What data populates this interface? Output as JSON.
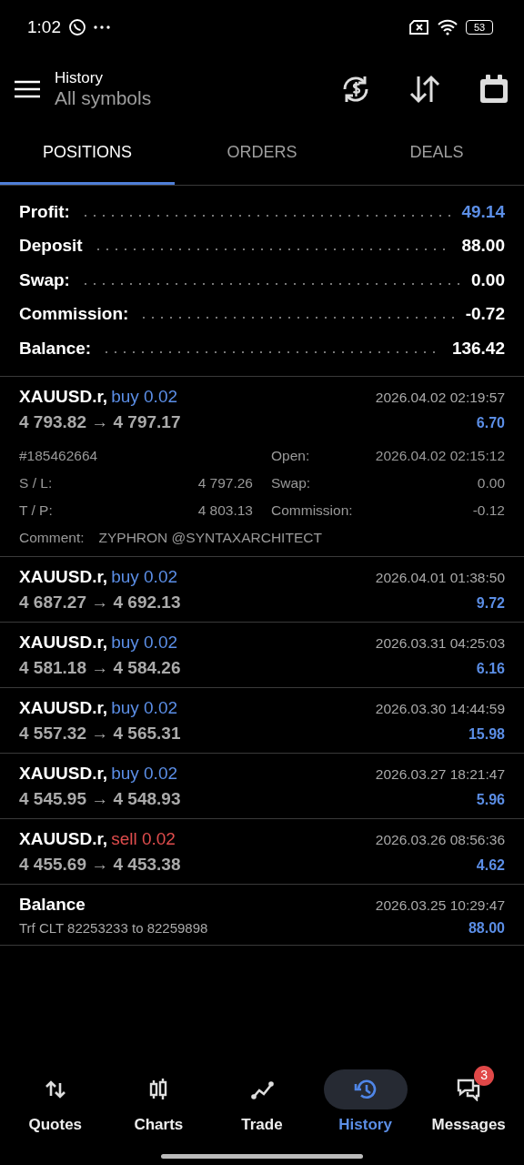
{
  "status_bar": {
    "time": "1:02",
    "battery": "53"
  },
  "header": {
    "title": "History",
    "subtitle": "All symbols"
  },
  "tabs": [
    {
      "label": "POSITIONS",
      "selected": true
    },
    {
      "label": "ORDERS",
      "selected": false
    },
    {
      "label": "DEALS",
      "selected": false
    }
  ],
  "summary": [
    {
      "label": "Profit:",
      "value": "49.14",
      "kind": "profit"
    },
    {
      "label": "Deposit",
      "value": "88.00",
      "kind": "plain"
    },
    {
      "label": "Swap:",
      "value": "0.00",
      "kind": "plain"
    },
    {
      "label": "Commission:",
      "value": "-0.72",
      "kind": "plain"
    },
    {
      "label": "Balance:",
      "value": "136.42",
      "kind": "plain"
    }
  ],
  "deals": [
    {
      "kind": "buy",
      "symbol": "XAUUSD.r,",
      "order": "buy 0.02",
      "prices": "4 793.82 → 4 797.17",
      "time": "2026.04.02 02:19:57",
      "profit": "6.70",
      "details": {
        "ticket": "#185462664",
        "open_label": "Open:",
        "open_time": "2026.04.02 02:15:12",
        "fields": [
          {
            "label": "S / L:",
            "value": "4 797.26"
          },
          {
            "label": "Swap:",
            "value": "0.00"
          },
          {
            "label": "T / P:",
            "value": "4 803.13"
          },
          {
            "label": "Commission:",
            "value": "-0.12"
          }
        ],
        "comment_label": "Comment:",
        "comment": "ZYPHRON @SYNTAXARCHITECT"
      }
    },
    {
      "kind": "buy",
      "symbol": "XAUUSD.r,",
      "order": "buy 0.02",
      "prices": "4 687.27 → 4 692.13",
      "time": "2026.04.01 01:38:50",
      "profit": "9.72"
    },
    {
      "kind": "buy",
      "symbol": "XAUUSD.r,",
      "order": "buy 0.02",
      "prices": "4 581.18 → 4 584.26",
      "time": "2026.03.31 04:25:03",
      "profit": "6.16"
    },
    {
      "kind": "buy",
      "symbol": "XAUUSD.r,",
      "order": "buy 0.02",
      "prices": "4 557.32 → 4 565.31",
      "time": "2026.03.30 14:44:59",
      "profit": "15.98"
    },
    {
      "kind": "buy",
      "symbol": "XAUUSD.r,",
      "order": "buy 0.02",
      "prices": "4 545.95 → 4 548.93",
      "time": "2026.03.27 18:21:47",
      "profit": "5.96"
    },
    {
      "kind": "sell",
      "symbol": "XAUUSD.r,",
      "order": "sell 0.02",
      "prices": "4 455.69 → 4 453.38",
      "time": "2026.03.26 08:56:36",
      "profit": "4.62"
    },
    {
      "kind": "balance",
      "symbol": "Balance",
      "prices": "Trf CLT 82253233 to 82259898",
      "time": "2026.03.25 10:29:47",
      "profit": "88.00"
    }
  ],
  "bottom_nav": [
    {
      "kind": "quotes",
      "label": "Quotes",
      "selected": false
    },
    {
      "kind": "charts",
      "label": "Charts",
      "selected": false
    },
    {
      "kind": "trade",
      "label": "Trade",
      "selected": false
    },
    {
      "kind": "history",
      "label": "History",
      "selected": true
    },
    {
      "kind": "messages",
      "label": "Messages",
      "selected": false,
      "badge": "3"
    }
  ]
}
